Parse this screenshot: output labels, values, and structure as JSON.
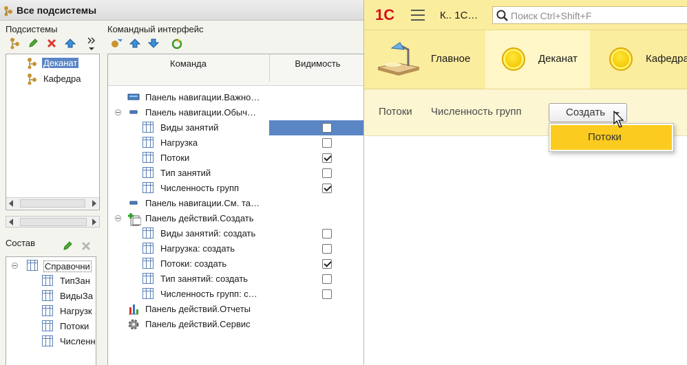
{
  "config_window": {
    "title": "Все подсистемы",
    "subsystems": {
      "label": "Подсистемы",
      "items": [
        {
          "label": "Деканат",
          "selected": true
        },
        {
          "label": "Кафедра",
          "selected": false
        }
      ]
    },
    "command_interface": {
      "label": "Командный интерфейс",
      "columns": [
        "Команда",
        "Видимость"
      ],
      "rows": [
        {
          "label": "Панель навигации.Важно…",
          "icon": "panel-blue-icon",
          "level": 0,
          "checkbox": null
        },
        {
          "label": "Панель навигации.Обыч…",
          "icon": "panel-small-icon",
          "level": 0,
          "expanded": true,
          "checkbox": null
        },
        {
          "label": "Виды занятий",
          "icon": "catalog-icon",
          "level": 1,
          "checkbox": false,
          "selected": true
        },
        {
          "label": "Нагрузка",
          "icon": "catalog-icon",
          "level": 1,
          "checkbox": false
        },
        {
          "label": "Потоки",
          "icon": "catalog-icon",
          "level": 1,
          "checkbox": true
        },
        {
          "label": "Тип занятий",
          "icon": "catalog-icon",
          "level": 1,
          "checkbox": false
        },
        {
          "label": "Численность групп",
          "icon": "catalog-icon",
          "level": 1,
          "checkbox": true
        },
        {
          "label": "Панель навигации.См. та…",
          "icon": "panel-small-icon",
          "level": 0,
          "checkbox": null
        },
        {
          "label": "Панель действий.Создать",
          "icon": "create-action-icon",
          "level": 0,
          "expanded": true,
          "checkbox": null
        },
        {
          "label": "Виды занятий: создать",
          "icon": "catalog-icon",
          "level": 1,
          "checkbox": false
        },
        {
          "label": "Нагрузка: создать",
          "icon": "catalog-icon",
          "level": 1,
          "checkbox": false
        },
        {
          "label": "Потоки: создать",
          "icon": "catalog-icon",
          "level": 1,
          "checkbox": true
        },
        {
          "label": "Тип занятий: создать",
          "icon": "catalog-icon",
          "level": 1,
          "checkbox": false
        },
        {
          "label": "Численность групп: с…",
          "icon": "catalog-icon",
          "level": 1,
          "checkbox": false
        },
        {
          "label": "Панель действий.Отчеты",
          "icon": "reports-icon",
          "level": 0,
          "checkbox": null
        },
        {
          "label": "Панель действий.Сервис",
          "icon": "service-gear-icon",
          "level": 0,
          "checkbox": null
        }
      ]
    },
    "content": {
      "label": "Состав",
      "root": "Справочни",
      "items": [
        "ТипЗан",
        "ВидыЗа",
        "Нагрузк",
        "Потоки",
        "Численн"
      ]
    }
  },
  "enterprise_window": {
    "logo": "1С",
    "caption": "К.. 1С…",
    "search_placeholder": "Поиск Ctrl+Shift+F",
    "sections": [
      {
        "label": "Главное",
        "icon": "desk-lamp-icon",
        "active": false
      },
      {
        "label": "Деканат",
        "icon": "yellow-circle-icon",
        "active": true
      },
      {
        "label": "Кафедра",
        "icon": "yellow-circle-icon",
        "active": false
      }
    ],
    "commands": [
      "Потоки",
      "Численность групп"
    ],
    "create_button": "Создать",
    "create_menu": [
      "Потоки"
    ]
  },
  "colors": {
    "accent_yellow": "#fbcb1f",
    "panel_yellow": "#fbed9e",
    "logo_red": "#d0121b",
    "selection_blue": "#5b86c5"
  }
}
